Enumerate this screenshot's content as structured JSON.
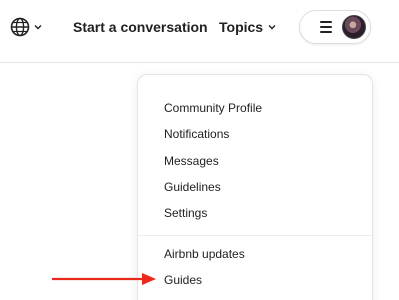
{
  "header": {
    "language_icon": "globe-icon",
    "language_chevron_icon": "chevron-down-icon",
    "start_conversation": "Start a conversation",
    "topics": "Topics",
    "topics_chevron_icon": "chevron-down-icon",
    "menu_icon": "hamburger-menu-icon",
    "avatar": "user-avatar"
  },
  "dropdown": {
    "items_primary": [
      "Community Profile",
      "Notifications",
      "Messages",
      "Guidelines",
      "Settings"
    ],
    "items_secondary": [
      "Airbnb updates",
      "Guides"
    ]
  },
  "annotation": {
    "arrow_color": "#e8291c",
    "target": "Guides"
  }
}
